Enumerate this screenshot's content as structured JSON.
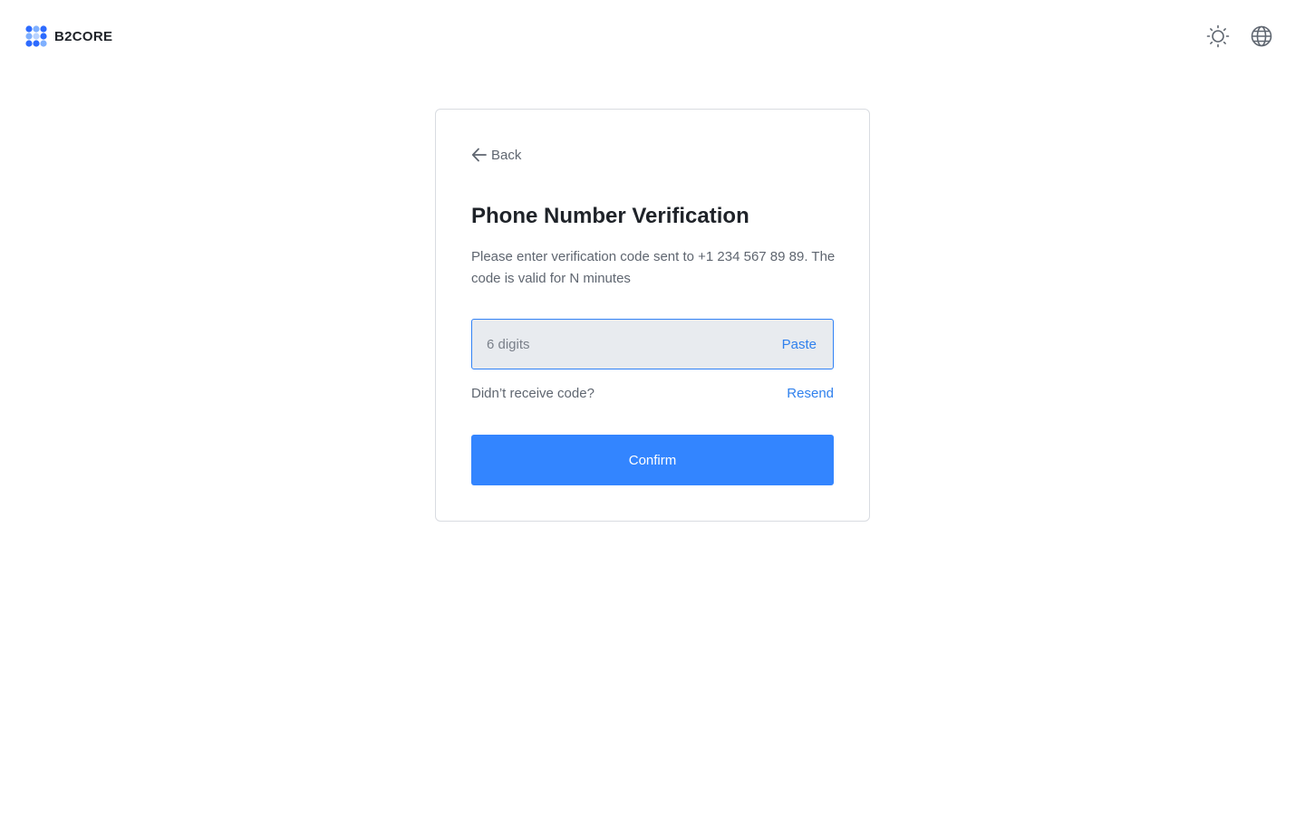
{
  "header": {
    "brand": "B2CORE",
    "logo_icon": "b2core-logo-icon",
    "theme_icon": "sun-icon",
    "language_icon": "globe-icon"
  },
  "card": {
    "back_label": "Back",
    "back_icon": "arrow-left-icon",
    "title": "Phone Number Verification",
    "description": "Please enter verification code sent to +1 234 567 89 89. The code is valid for N minutes",
    "code_input": {
      "value": "",
      "placeholder": "6 digits",
      "paste_label": "Paste"
    },
    "resend_question": "Didn’t receive code?",
    "resend_label": "Resend",
    "confirm_label": "Confirm"
  },
  "colors": {
    "accent": "#3385ff",
    "link": "#2f80ed",
    "input_bg": "#e8ebef",
    "text_primary": "#1f2329",
    "text_secondary": "#5f6670"
  }
}
